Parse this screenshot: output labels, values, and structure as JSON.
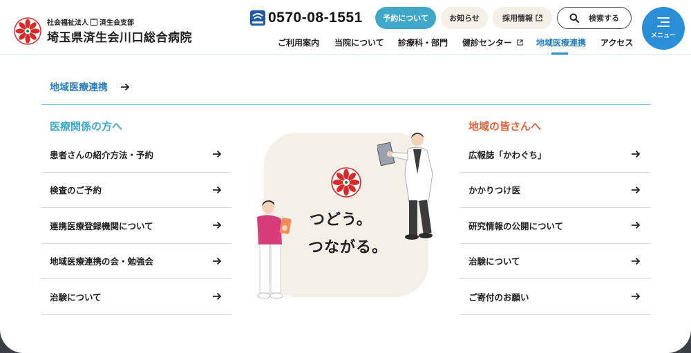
{
  "header": {
    "org_prefix": "社会福祉法人",
    "org_kanji_box": "恩賜財団",
    "org_branch": "済生会支部",
    "hospital_name": "埼玉県済生会川口総合病院",
    "phone_number": "0570-08-1551",
    "buttons": {
      "reserve": "予約について",
      "news": "お知らせ",
      "recruit": "採用情報",
      "search": "検索する"
    },
    "menu_label": "メニュー",
    "nav": [
      {
        "label": "ご利用案内"
      },
      {
        "label": "当院について"
      },
      {
        "label": "診療科・部門"
      },
      {
        "label": "健診センター"
      },
      {
        "label": "地域医療連携"
      },
      {
        "label": "アクセス"
      }
    ],
    "colors": {
      "accent": "#3fa7c8",
      "menu": "#2a8fd6",
      "active_nav": "#2a7fb8"
    }
  },
  "panel": {
    "section_title": "地域医療連携",
    "left": {
      "heading": "医療関係の方へ",
      "items": [
        {
          "label": "患者さんの紹介方法・予約"
        },
        {
          "label": "検査のご予約"
        },
        {
          "label": "連携医療登録機関について"
        },
        {
          "label": "地域医療連携の会・勉強会"
        },
        {
          "label": "治験について"
        }
      ]
    },
    "right": {
      "heading": "地域の皆さんへ",
      "items": [
        {
          "label": "広報誌「かわぐち」"
        },
        {
          "label": "かかりつけ医"
        },
        {
          "label": "研究情報の公開について"
        },
        {
          "label": "治験について"
        },
        {
          "label": "ご寄付のお願い"
        }
      ]
    },
    "tagline_line1": "つどう。",
    "tagline_line2": "つながる。",
    "colors": {
      "left_heading": "#3fa7c8",
      "right_heading": "#e0613a"
    }
  }
}
